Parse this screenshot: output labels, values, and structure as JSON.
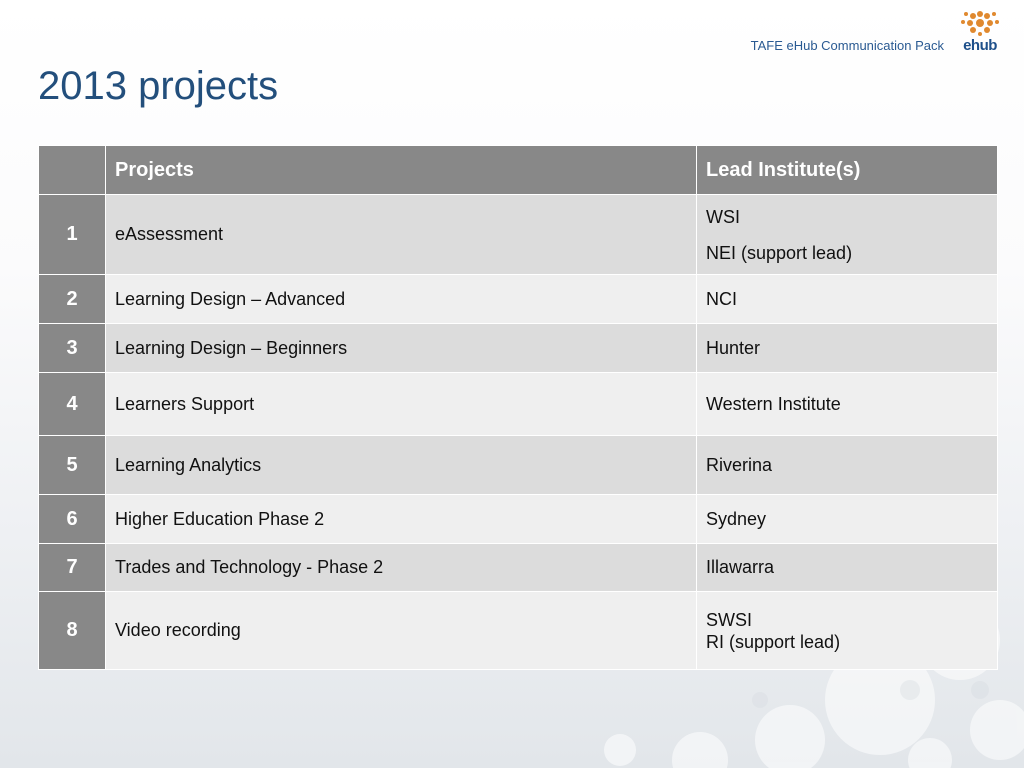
{
  "header": {
    "pack_title": "TAFE eHub Communication Pack",
    "logo_text": "ehub"
  },
  "slide": {
    "title": "2013 projects"
  },
  "table": {
    "columns": [
      "",
      "Projects",
      "Lead Institute(s)"
    ],
    "rows": [
      {
        "num": "1",
        "project": "eAssessment",
        "lead": [
          "WSI",
          "NEI  (support lead)"
        ]
      },
      {
        "num": "2",
        "project": "Learning Design – Advanced",
        "lead": [
          "NCI"
        ]
      },
      {
        "num": "3",
        "project": "Learning Design – Beginners",
        "lead": [
          "Hunter"
        ]
      },
      {
        "num": "4",
        "project": "Learners Support",
        "lead": [
          "Western Institute"
        ]
      },
      {
        "num": "5",
        "project": "Learning Analytics",
        "lead": [
          "Riverina"
        ]
      },
      {
        "num": "6",
        "project": "Higher Education Phase 2",
        "lead": [
          "Sydney"
        ]
      },
      {
        "num": "7",
        "project": "Trades and Technology - Phase 2",
        "lead": [
          "Illawarra"
        ]
      },
      {
        "num": "8",
        "project": "Video recording",
        "lead": [
          "SWSI",
          "RI (support lead)"
        ]
      }
    ]
  },
  "colors": {
    "title": "#234f7c",
    "header_fill": "#888888",
    "row_dark": "#dcdcdc",
    "row_light": "#efefef",
    "logo_orange": "#e0892f",
    "logo_blue": "#1d4f8a"
  }
}
